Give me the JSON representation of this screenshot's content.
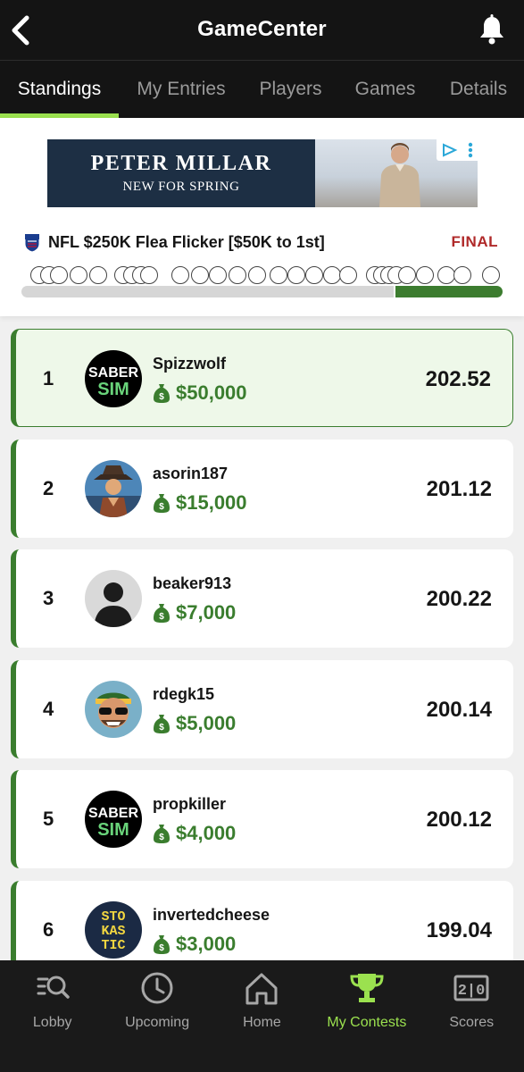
{
  "header": {
    "title": "GameCenter",
    "back_icon": "chevron-left-icon",
    "bell_icon": "bell-icon"
  },
  "tabs": [
    {
      "label": "Standings",
      "active": true
    },
    {
      "label": "My Entries",
      "active": false
    },
    {
      "label": "Players",
      "active": false
    },
    {
      "label": "Games",
      "active": false
    },
    {
      "label": "Details",
      "active": false
    }
  ],
  "ad": {
    "brand": "PETER MILLAR",
    "tagline": "NEW FOR SPRING"
  },
  "contest": {
    "name": "NFL $250K Flea Flicker [$50K to 1st]",
    "status": "FINAL",
    "status_color": "#b02a2a",
    "accent_color": "#3a7d2e"
  },
  "standings": [
    {
      "rank": "1",
      "username": "Spizzwolf",
      "prize": "$50,000",
      "score": "202.52",
      "avatar": "sabersim-logo",
      "highlighted": true
    },
    {
      "rank": "2",
      "username": "asorin187",
      "prize": "$15,000",
      "score": "201.12",
      "avatar": "illustrated-cowboy-avatar"
    },
    {
      "rank": "3",
      "username": "beaker913",
      "prize": "$7,000",
      "score": "200.22",
      "avatar": "default-silhouette-avatar"
    },
    {
      "rank": "4",
      "username": "rdegk15",
      "prize": "$5,000",
      "score": "200.14",
      "avatar": "cartoon-sunglasses-avatar"
    },
    {
      "rank": "5",
      "username": "propkiller",
      "prize": "$4,000",
      "score": "200.12",
      "avatar": "sabersim-logo"
    },
    {
      "rank": "6",
      "username": "invertedcheese",
      "prize": "$3,000",
      "score": "199.04",
      "avatar": "stokastic-logo"
    }
  ],
  "avatar_text": {
    "saber_top": "SABER",
    "saber_bottom": "SIM",
    "stokastic_lines": [
      "STO",
      "KAS",
      "TIC"
    ]
  },
  "bottom_nav": [
    {
      "label": "Lobby",
      "icon": "lobby-search-icon",
      "active": false
    },
    {
      "label": "Upcoming",
      "icon": "clock-icon",
      "active": false
    },
    {
      "label": "Home",
      "icon": "home-icon",
      "active": false
    },
    {
      "label": "My Contests",
      "icon": "trophy-icon",
      "active": true
    },
    {
      "label": "Scores",
      "icon": "scoreboard-icon",
      "active": false
    }
  ],
  "scoreboard_icon_text": "2|0"
}
